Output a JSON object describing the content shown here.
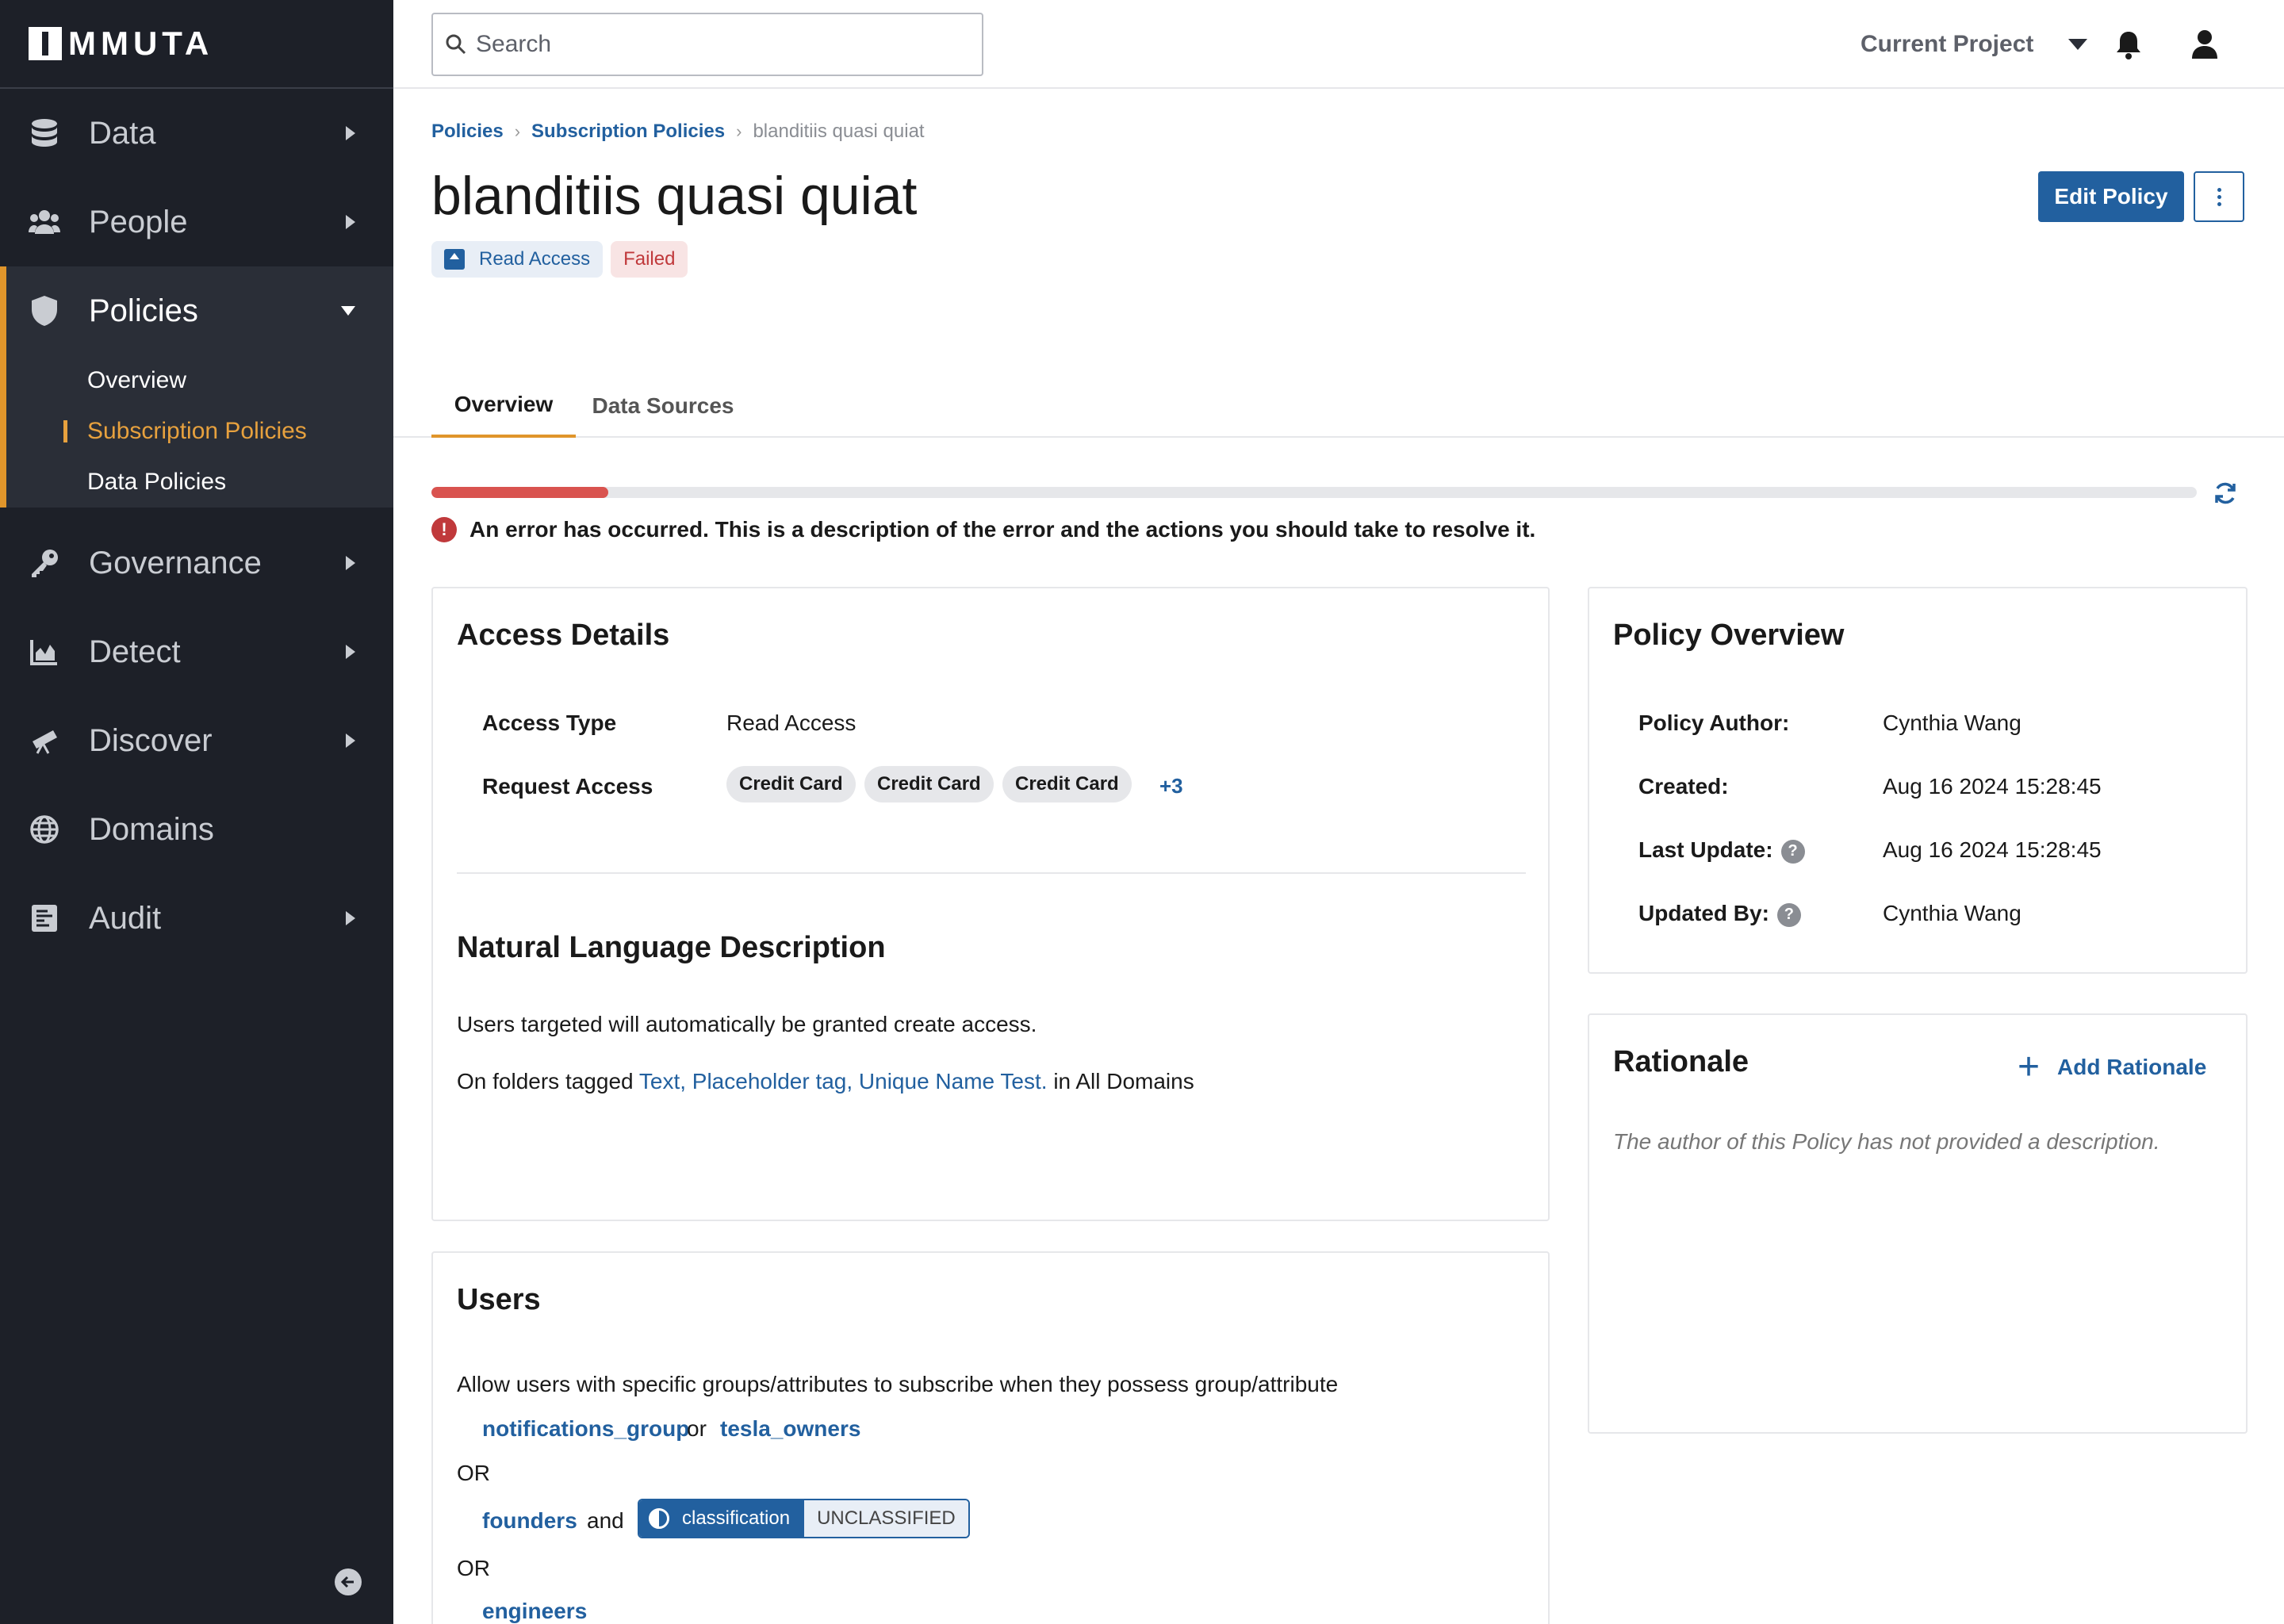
{
  "app": {
    "logo_text": "MMUTA"
  },
  "sidebar": {
    "items": [
      {
        "label": "Data",
        "icon": "database-icon"
      },
      {
        "label": "People",
        "icon": "people-icon"
      },
      {
        "label": "Policies",
        "icon": "shield-icon"
      },
      {
        "label": "Governance",
        "icon": "key-icon"
      },
      {
        "label": "Detect",
        "icon": "area-chart-icon"
      },
      {
        "label": "Discover",
        "icon": "telescope-icon"
      },
      {
        "label": "Domains",
        "icon": "globe-icon"
      },
      {
        "label": "Audit",
        "icon": "audit-icon"
      }
    ],
    "policies_sub": [
      "Overview",
      "Subscription Policies",
      "Data Policies"
    ]
  },
  "topbar": {
    "search_placeholder": "Search",
    "project_label": "Current Project"
  },
  "breadcrumb": [
    "Policies",
    "Subscription Policies",
    "blanditiis quasi quiat"
  ],
  "page": {
    "title": "blanditiis quasi quiat",
    "badge_type": "Read Access",
    "badge_status": "Failed",
    "edit_label": "Edit Policy"
  },
  "tabs": [
    "Overview",
    "Data Sources"
  ],
  "status": {
    "progress_fraction": 0.1,
    "error_text": "An error has occurred. This is a description of the error and the actions you should take to resolve it."
  },
  "access_details": {
    "title": "Access Details",
    "access_type_label": "Access Type",
    "access_type_value": "Read Access",
    "request_access_label": "Request Access",
    "chips": [
      "Credit Card",
      "Credit Card",
      "Credit Card"
    ],
    "more": "+3",
    "nl_title": "Natural Language Description",
    "nl_line1": "Users targeted will automatically be granted create access.",
    "nl_line2_prefix": "On folders tagged",
    "nl_line2_tags": "Text, Placeholder tag, Unique Name Test.",
    "nl_line2_suffix": "in All Domains"
  },
  "users": {
    "title": "Users",
    "description": "Allow users with specific groups/attributes to subscribe when they possess group/attribute",
    "group1": "notifications_group",
    "or_inline": "or",
    "group2": "tesla_owners",
    "or1": "OR",
    "group3": "founders",
    "and": "and",
    "attr_key": "classification",
    "attr_value": "UNCLASSIFIED",
    "or2": "OR",
    "group4": "engineers"
  },
  "policy_overview": {
    "title": "Policy Overview",
    "author_label": "Policy Author:",
    "author_value": "Cynthia Wang",
    "created_label": "Created:",
    "created_value": "Aug 16 2024 15:28:45",
    "updated_label": "Last Update:",
    "updated_value": "Aug 16 2024 15:28:45",
    "updated_by_label": "Updated By:",
    "updated_by_value": "Cynthia Wang"
  },
  "rationale": {
    "title": "Rationale",
    "add_label": "Add Rationale",
    "empty_text": "The author of this Policy has not provided a description."
  },
  "colors": {
    "accent": "#22609f",
    "active_nav": "#e0952b",
    "error": "#c0393b",
    "sidebar_bg": "#1d2028"
  }
}
